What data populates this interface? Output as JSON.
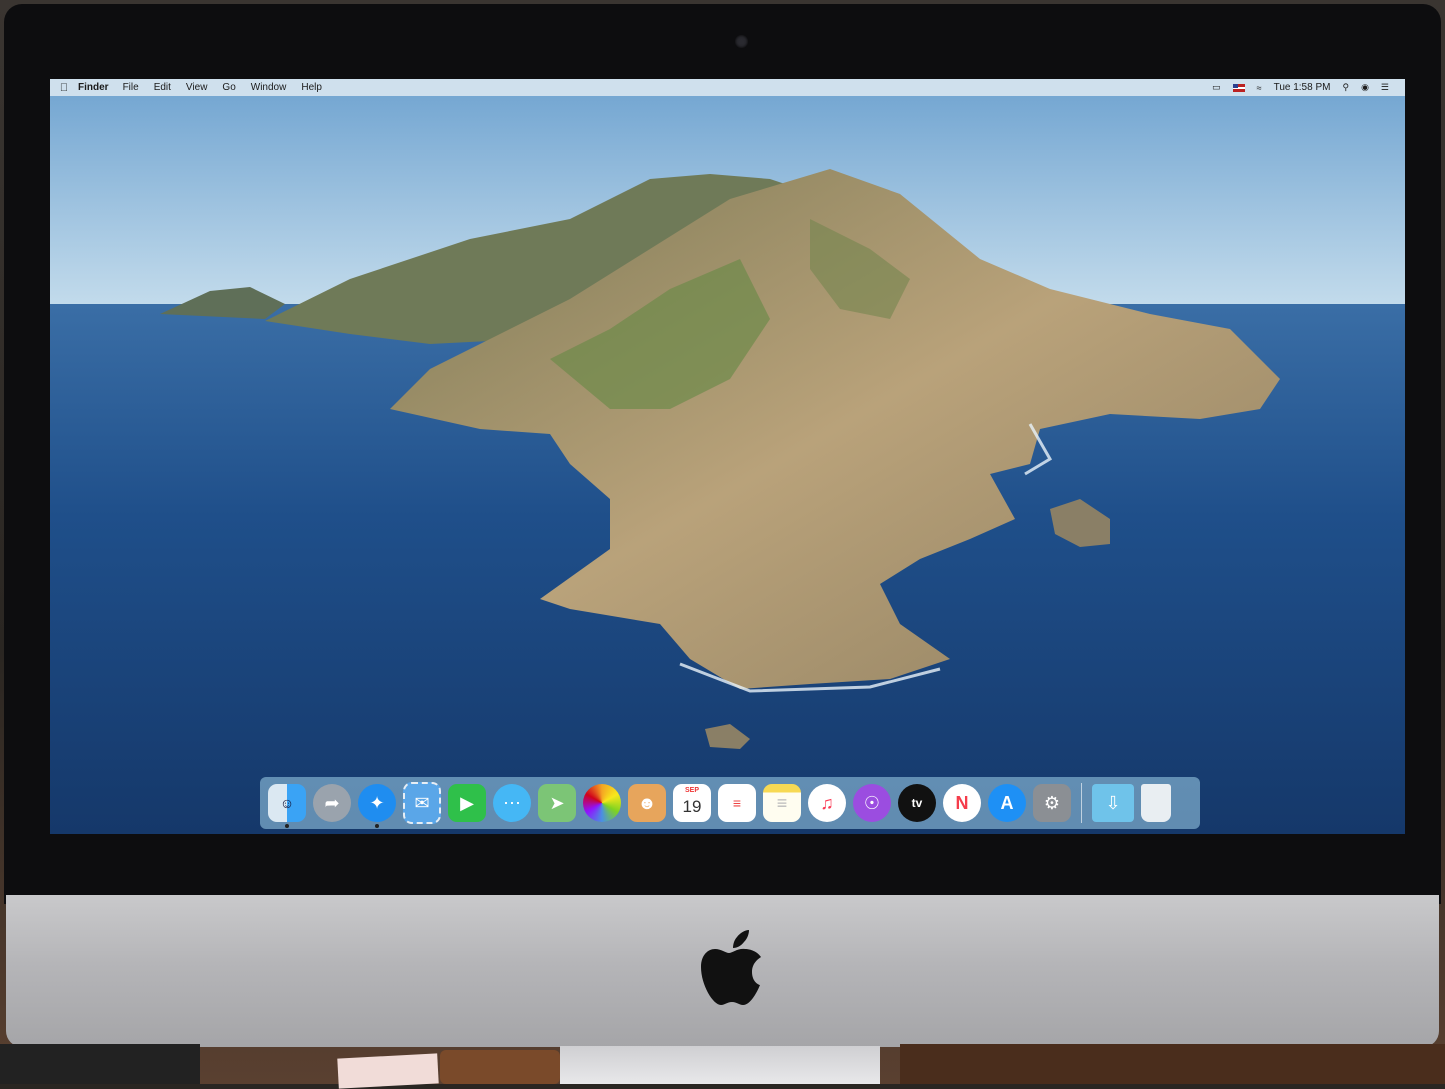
{
  "menubar": {
    "app_name": "Finder",
    "menus": [
      "File",
      "Edit",
      "View",
      "Go",
      "Window",
      "Help"
    ],
    "clock": "Tue 1:58 PM",
    "status_icons": [
      "airplay-icon",
      "us-flag-input-icon",
      "wifi-icon",
      "spotlight-icon",
      "siri-icon",
      "notification-center-icon"
    ]
  },
  "dock": {
    "apps": [
      {
        "name": "finder",
        "icon": "finder-icon",
        "color": "#3aa3f5"
      },
      {
        "name": "launchpad",
        "icon": "rocket-icon",
        "color": "#9aa3ad"
      },
      {
        "name": "safari",
        "icon": "compass-icon",
        "color": "#1f8df0"
      },
      {
        "name": "mail",
        "icon": "stamp-icon",
        "color": "#5aa6e8"
      },
      {
        "name": "facetime",
        "icon": "camera-icon",
        "color": "#2fc04a"
      },
      {
        "name": "messages",
        "icon": "speech-bubble-icon",
        "color": "#45b7f5"
      },
      {
        "name": "maps",
        "icon": "map-icon",
        "color": "#7cc576"
      },
      {
        "name": "photos",
        "icon": "pinwheel-icon",
        "color": "#ffffff"
      },
      {
        "name": "contacts",
        "icon": "address-book-icon",
        "color": "#e7a55c"
      },
      {
        "name": "calendar",
        "icon": "calendar-icon",
        "color": "#ffffff"
      },
      {
        "name": "reminders",
        "icon": "checklist-icon",
        "color": "#ffffff"
      },
      {
        "name": "notes",
        "icon": "notepad-icon",
        "color": "#f7d954"
      },
      {
        "name": "music",
        "icon": "music-note-icon",
        "color": "#fa3a55"
      },
      {
        "name": "podcasts",
        "icon": "podcast-icon",
        "color": "#9b4de0"
      },
      {
        "name": "tv",
        "icon": "appletv-icon",
        "color": "#111111"
      },
      {
        "name": "news",
        "icon": "news-icon",
        "color": "#f53c4b"
      },
      {
        "name": "app-store",
        "icon": "app-store-icon",
        "color": "#1e90f5"
      },
      {
        "name": "system-preferences",
        "icon": "gear-icon",
        "color": "#8b8f94"
      }
    ],
    "calendar": {
      "month": "SEP",
      "day": "19"
    },
    "tv_label": "tv",
    "extras": [
      {
        "name": "downloads",
        "icon": "downloads-folder-icon",
        "color": "#6fc3ea"
      },
      {
        "name": "trash",
        "icon": "trash-icon",
        "color": "#e9eef2"
      }
    ]
  },
  "colors": {
    "menubar_bg": "#dce8f0",
    "sky": "#a5c9e2",
    "ocean": "#1f4f8a",
    "island": "#8c7a55"
  }
}
